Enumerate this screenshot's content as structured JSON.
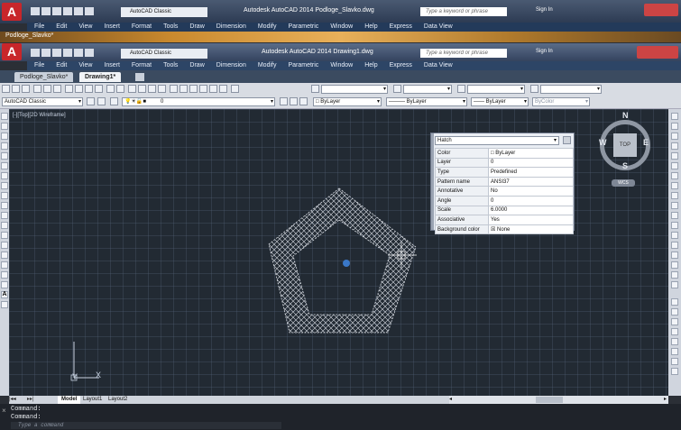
{
  "back_window": {
    "title": "Autodesk AutoCAD 2014   Podloge_Slavko.dwg",
    "workspace": "AutoCAD Classic",
    "search_placeholder": "Type a keyword or phrase",
    "signin": "Sign In",
    "menu": [
      "File",
      "Edit",
      "View",
      "Insert",
      "Format",
      "Tools",
      "Draw",
      "Dimension",
      "Modify",
      "Parametric",
      "Window",
      "Help",
      "Express",
      "Data View"
    ],
    "tab": "Podloge_Slavko*"
  },
  "front_window": {
    "title": "Autodesk AutoCAD 2014   Drawing1.dwg",
    "workspace": "AutoCAD Classic",
    "search_placeholder": "Type a keyword or phrase",
    "signin": "Sign In",
    "menu": [
      "File",
      "Edit",
      "View",
      "Insert",
      "Format",
      "Tools",
      "Draw",
      "Dimension",
      "Modify",
      "Parametric",
      "Window",
      "Help",
      "Express",
      "Data View"
    ],
    "tabs": [
      "Podloge_Slavko*",
      "Drawing1*"
    ]
  },
  "toolbar": {
    "workspace_combo": "AutoCAD Classic",
    "layer_combo": "0",
    "color_combo": "ByLayer",
    "linetype_combo": "ByLayer",
    "lineweight_combo": "ByLayer",
    "plotstyle_combo": "ByColor"
  },
  "viewport": {
    "label": "[-][Top][2D Wireframe]"
  },
  "viewcube": {
    "n": "N",
    "s": "S",
    "e": "E",
    "w": "W",
    "top": "TOP",
    "wcs": "WCS"
  },
  "properties": {
    "object_type": "Hatch",
    "rows": [
      {
        "k": "Color",
        "v": "ByLayer"
      },
      {
        "k": "Layer",
        "v": "0"
      },
      {
        "k": "Type",
        "v": "Predefined"
      },
      {
        "k": "Pattern name",
        "v": "ANSI37"
      },
      {
        "k": "Annotative",
        "v": "No"
      },
      {
        "k": "Angle",
        "v": "0"
      },
      {
        "k": "Scale",
        "v": "6.0000"
      },
      {
        "k": "Associative",
        "v": "Yes"
      },
      {
        "k": "Background color",
        "v": "None"
      }
    ]
  },
  "ucs": {
    "x": "X",
    "y": "Y"
  },
  "layout_tabs": [
    "Model",
    "Layout1",
    "Layout2"
  ],
  "command": {
    "line1": "Command:",
    "line2": "Command:",
    "placeholder": "Type a command"
  },
  "colors": {
    "canvas": "#222a33",
    "hatch": "#d9dde4",
    "accent": "#3a78c8"
  }
}
